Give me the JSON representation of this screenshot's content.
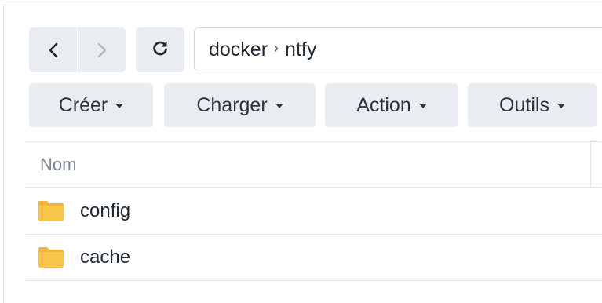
{
  "navigation": {
    "back_icon": "chevron-left-icon",
    "forward_icon": "chevron-right-icon",
    "refresh_icon": "refresh-icon"
  },
  "path": {
    "segments": [
      "docker",
      "ntfy"
    ],
    "separator": "›"
  },
  "toolbar": {
    "create_label": "Créer",
    "upload_label": "Charger",
    "action_label": "Action",
    "tools_label": "Outils"
  },
  "table": {
    "columns": [
      "Nom"
    ],
    "rows": [
      {
        "name": "config",
        "icon": "folder-icon"
      },
      {
        "name": "cache",
        "icon": "folder-icon"
      }
    ]
  },
  "colors": {
    "button_bg": "#e9edf2",
    "folder": "#f7c548",
    "folder_tab": "#f0b43a",
    "border": "#dfe4ea"
  }
}
